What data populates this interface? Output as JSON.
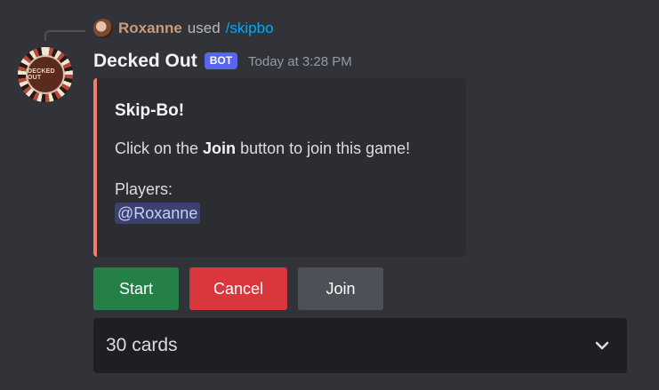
{
  "reference": {
    "user": "Roxanne",
    "verb": "used",
    "command": "/skipbo"
  },
  "message": {
    "author": "Decked Out",
    "author_avatar_text": "DECKED OUT",
    "bot_tag": "BOT",
    "timestamp": "Today at 3:28 PM"
  },
  "embed": {
    "accent_color": "#f47b67",
    "title": "Skip-Bo!",
    "desc_prefix": "Click on the ",
    "desc_bold": "Join",
    "desc_suffix": " button to join this game!",
    "players_label": "Players:",
    "players": [
      "@Roxanne"
    ]
  },
  "buttons": {
    "start": {
      "label": "Start",
      "color": "#248046"
    },
    "cancel": {
      "label": "Cancel",
      "color": "#da373c"
    },
    "join": {
      "label": "Join",
      "color": "#4e5058"
    }
  },
  "select": {
    "value": "30 cards",
    "icon": "chevron-down-icon"
  }
}
